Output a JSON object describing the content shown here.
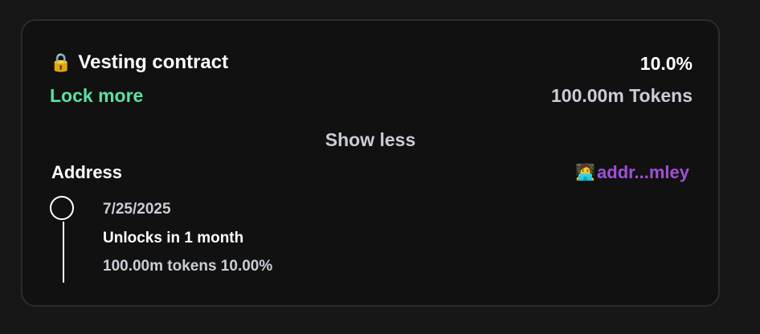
{
  "card": {
    "lock_icon": "🔒",
    "title": "Vesting contract",
    "percent": "10.0%",
    "lock_more_label": "Lock more",
    "tokens": "100.00m Tokens",
    "show_less_label": "Show less",
    "address_label": "Address",
    "address_icon": "🧑‍💻",
    "address_value": "addr...mley"
  },
  "timeline": {
    "events": [
      {
        "date": "7/25/2025",
        "title": "Unlocks in 1 month",
        "amount": "100.00m tokens 10.00%"
      }
    ]
  },
  "colors": {
    "background": "#171717",
    "card": "#111111",
    "accent_green": "#5be0a0",
    "accent_purple": "#a24fd8",
    "muted_text": "#c9cdd6"
  }
}
